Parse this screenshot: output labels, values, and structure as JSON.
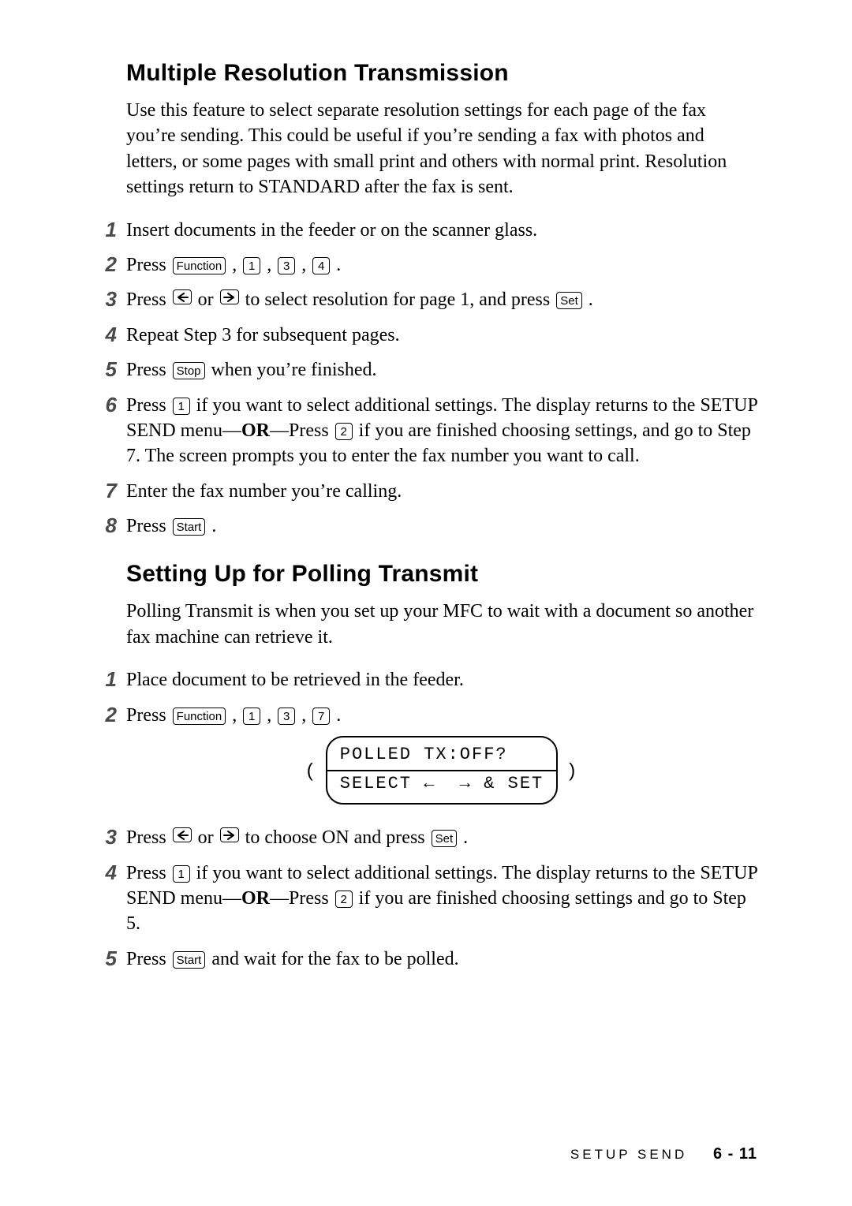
{
  "section1": {
    "title": "Multiple Resolution Transmission",
    "intro": "Use this feature to select separate resolution settings for each page of the fax you’re sending.  This could be useful if you’re sending a fax with photos and letters, or some pages with small print and others with normal print.  Resolution settings return to STANDARD after the fax is sent.",
    "steps": {
      "s1": "Insert documents in the feeder or on the scanner glass.",
      "s2_a": "Press ",
      "s2_fn": "Function",
      "s2_b": ", ",
      "s2_k1": "1",
      "s2_c": ", ",
      "s2_k2": "3",
      "s2_d": ", ",
      "s2_k3": "4",
      "s2_e": ".",
      "s3_a": "Press ",
      "s3_b": " or ",
      "s3_c": " to select resolution for page 1, and press ",
      "s3_set": "Set",
      "s3_d": ".",
      "s4": "Repeat Step 3 for subsequent pages.",
      "s5_a": "Press ",
      "s5_stop": "Stop",
      "s5_b": " when you’re finished.",
      "s6_a": "Press ",
      "s6_k1": "1",
      "s6_b": " if you want to select additional settings. The display returns to the SETUP SEND menu—",
      "s6_or": "OR",
      "s6_c": "—Press ",
      "s6_k2": "2",
      "s6_d": " if you are finished choosing settings, and go to Step 7. The screen prompts you to enter the fax number you want to call.",
      "s7": "Enter the fax number you’re calling.",
      "s8_a": "Press ",
      "s8_start": "Start",
      "s8_b": "."
    }
  },
  "section2": {
    "title": "Setting Up for Polling Transmit",
    "intro": "Polling Transmit is when you set up your MFC to wait with a document so another fax machine can retrieve it.",
    "steps": {
      "s1": "Place document to be retrieved in the feeder.",
      "s2_a": "Press ",
      "s2_fn": "Function",
      "s2_b": ", ",
      "s2_k1": "1",
      "s2_c": ", ",
      "s2_k2": "3",
      "s2_d": ", ",
      "s2_k3": "7",
      "s2_e": ".",
      "lcd_line1": "POLLED TX:OFF?",
      "lcd_line2": "SELECT ←  → & SET",
      "s3_a": "Press ",
      "s3_b": " or ",
      "s3_c": " to choose ON and press ",
      "s3_set": "Set",
      "s3_d": ".",
      "s4_a": "Press ",
      "s4_k1": "1",
      "s4_b": " if you want to select additional settings. The display returns to the SETUP SEND menu—",
      "s4_or": "OR",
      "s4_c": "—Press ",
      "s4_k2": "2",
      "s4_d": " if you are finished choosing settings and go to Step 5.",
      "s5_a": "Press ",
      "s5_start": "Start",
      "s5_b": " and wait for the fax to be polled."
    }
  },
  "footer": {
    "chapter": "SETUP SEND",
    "page": "6 - 11"
  }
}
